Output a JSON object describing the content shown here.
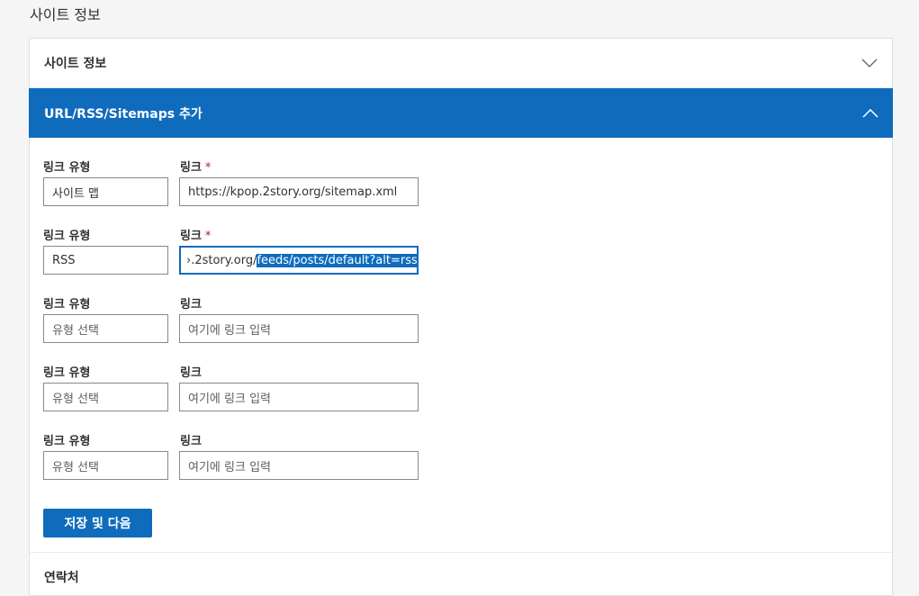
{
  "page": {
    "heading": "사이트 정보"
  },
  "accordion": {
    "site_info": {
      "title": "사이트 정보",
      "expanded": false
    },
    "url_section": {
      "title": "URL/RSS/Sitemaps 추가",
      "expanded": true
    },
    "next_section": {
      "title": "연락처"
    }
  },
  "form": {
    "rows": [
      {
        "type_label": "링크 유형",
        "link_label": "링크",
        "required": "*",
        "type_value": "사이트 맵",
        "link_value": "https://kpop.2story.org/sitemap.xml"
      },
      {
        "type_label": "링크 유형",
        "link_label": "링크",
        "required": "*",
        "type_value": "RSS",
        "link_value_unselected": "›.2story.org/",
        "link_value_selected": "feeds/posts/default?alt=rss"
      },
      {
        "type_label": "링크 유형",
        "link_label": "링크",
        "type_placeholder": "유형 선택",
        "link_placeholder": "여기에 링크 입력"
      },
      {
        "type_label": "링크 유형",
        "link_label": "링크",
        "type_placeholder": "유형 선택",
        "link_placeholder": "여기에 링크 입력"
      },
      {
        "type_label": "링크 유형",
        "link_label": "링크",
        "type_placeholder": "유형 선택",
        "link_placeholder": "여기에 링크 입력"
      }
    ],
    "save_button": "저장 및 다음"
  },
  "colors": {
    "accent": "#0f6cbd",
    "required": "#a4262c",
    "background": "#f5f5f5"
  },
  "icons": {
    "collapsed_chevron": "chevron-down-icon",
    "expanded_chevron": "chevron-up-icon"
  }
}
